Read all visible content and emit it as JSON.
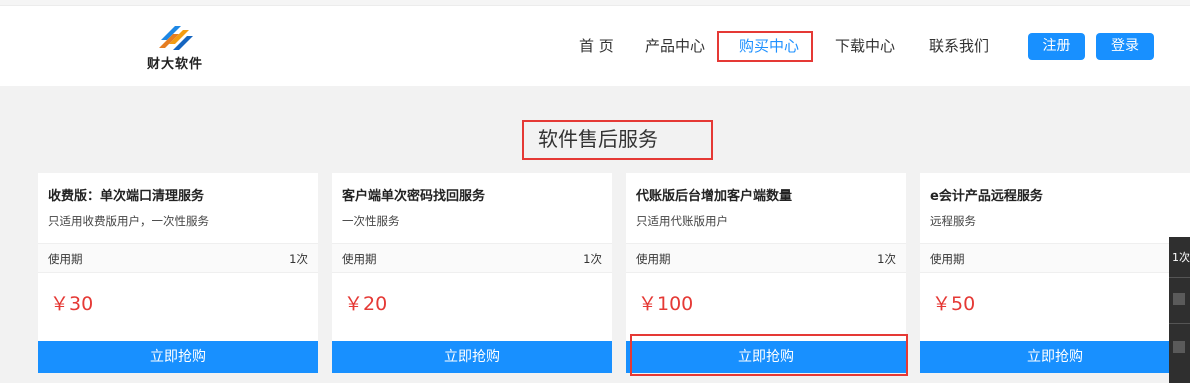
{
  "brand": {
    "name": "财大软件"
  },
  "nav": {
    "items": [
      "首 页",
      "产品中心",
      "购买中心",
      "下载中心",
      "联系我们"
    ],
    "register": "注册",
    "login": "登录"
  },
  "section": {
    "title": "软件售后服务"
  },
  "cards": [
    {
      "title": "收费版：单次端口清理服务",
      "desc": "只适用收费版用户，一次性服务",
      "meta_label": "使用期",
      "meta_value": "1次",
      "price": "￥30",
      "button": "立即抢购"
    },
    {
      "title": "客户端单次密码找回服务",
      "desc": "一次性服务",
      "meta_label": "使用期",
      "meta_value": "1次",
      "price": "￥20",
      "button": "立即抢购"
    },
    {
      "title": "代账版后台增加客户端数量",
      "desc": "只适用代账版用户",
      "meta_label": "使用期",
      "meta_value": "1次",
      "price": "￥100",
      "button": "立即抢购"
    },
    {
      "title": "e会计产品远程服务",
      "desc": "远程服务",
      "meta_label": "使用期",
      "meta_value": "1次",
      "price": "￥50",
      "button": "立即抢购"
    }
  ],
  "side_panel": {
    "text": "1次"
  },
  "colors": {
    "accent": "#1890ff",
    "price": "#e53935",
    "highlight": "#e53935"
  }
}
